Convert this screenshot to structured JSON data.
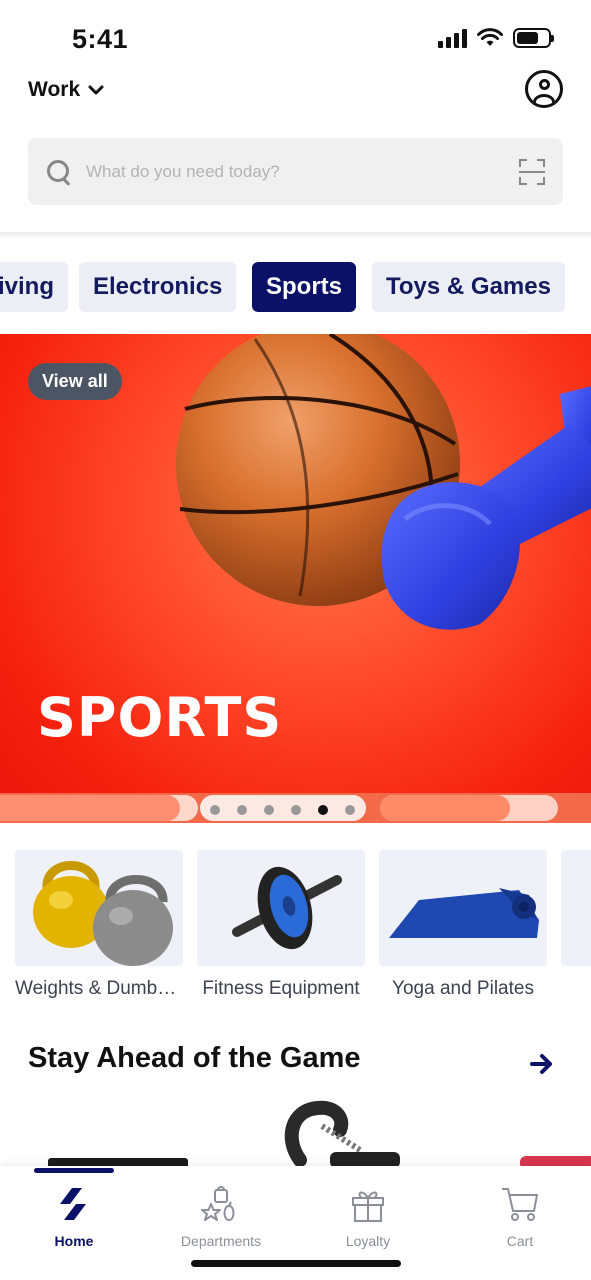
{
  "status_bar": {
    "time": "5:41"
  },
  "header": {
    "location_label": "Work"
  },
  "search": {
    "placeholder": "What do you need today?"
  },
  "categories": [
    {
      "label": "Living",
      "active": false
    },
    {
      "label": "Electronics",
      "active": false
    },
    {
      "label": "Sports",
      "active": true
    },
    {
      "label": "Toys & Games",
      "active": false
    }
  ],
  "banner": {
    "view_all_label": "View all",
    "title": "SPORTS",
    "slide_count": 6,
    "active_slide": 5
  },
  "subcategories": [
    {
      "label": "Weights & Dumbbells",
      "icon": "kettlebells"
    },
    {
      "label": "Fitness Equipment",
      "icon": "ab-roller"
    },
    {
      "label": "Yoga and Pilates",
      "icon": "yoga-mat"
    }
  ],
  "section": {
    "title": "Stay Ahead of the Game"
  },
  "bottom_nav": {
    "items": [
      {
        "label": "Home",
        "icon": "home-logo-icon",
        "active": true
      },
      {
        "label": "Departments",
        "icon": "departments-icon",
        "active": false
      },
      {
        "label": "Loyalty",
        "icon": "gift-icon",
        "active": false
      },
      {
        "label": "Cart",
        "icon": "cart-icon",
        "active": false
      }
    ]
  },
  "colors": {
    "brand_navy": "#0b1166",
    "chip_bg": "#eceef6",
    "banner_red": "#f5220f",
    "tile_bg": "#eef1f7"
  }
}
